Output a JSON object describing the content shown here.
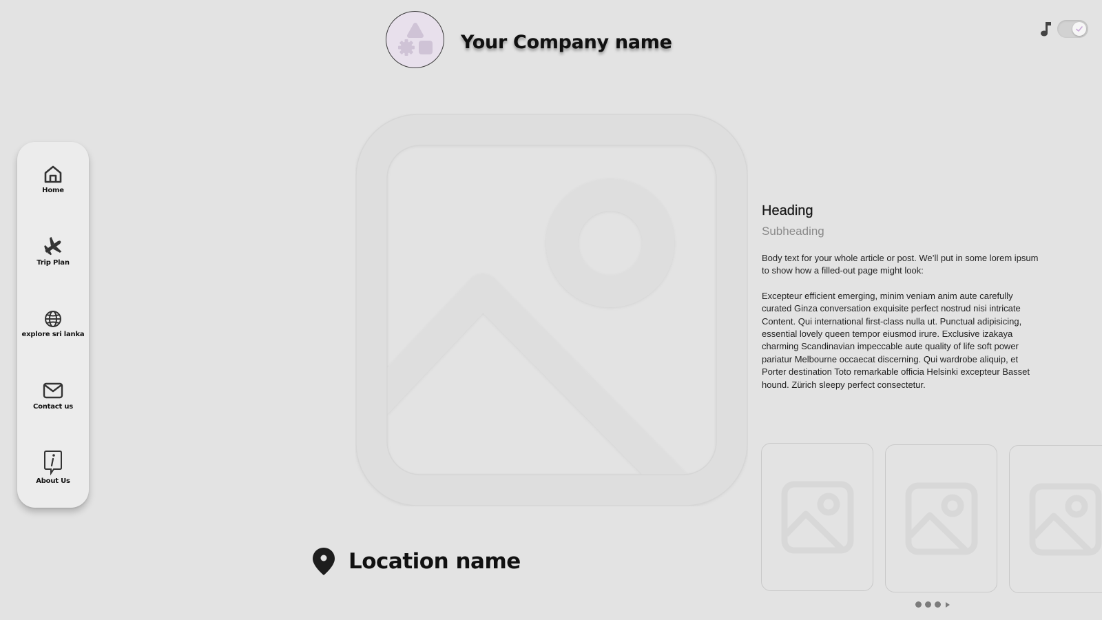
{
  "header": {
    "company_name": "Your Company name"
  },
  "controls": {
    "music_icon": "music-note-icon",
    "toggle_state": "on"
  },
  "sidebar": {
    "items": [
      {
        "label": "Home",
        "icon": "home-icon"
      },
      {
        "label": "Trip Plan",
        "icon": "airplane-icon"
      },
      {
        "label": "explore sri lanka",
        "icon": "globe-icon"
      },
      {
        "label": "Contact us",
        "icon": "mail-icon"
      },
      {
        "label": "About Us",
        "icon": "info-icon"
      }
    ]
  },
  "location": {
    "name": "Location name",
    "icon": "map-pin-icon"
  },
  "article": {
    "heading": "Heading",
    "subheading": "Subheading",
    "paragraphs": [
      "Body text for your whole article or post. We’ll put in some lorem ipsum to show how a filled-out page might look:",
      "Excepteur efficient emerging, minim veniam anim aute carefully curated Ginza conversation exquisite perfect nostrud nisi intricate Content. Qui  international first-class nulla ut. Punctual adipisicing, essential lovely queen tempor eiusmod irure. Exclusive izakaya charming Scandinavian impeccable aute quality of life soft power pariatur Melbourne occaecat discerning. Qui wardrobe aliquip, et Porter destination Toto remarkable officia Helsinki excepteur Basset hound. Zürich sleepy perfect consectetur."
    ]
  },
  "gallery": {
    "thumbnail_count": 3,
    "pager_dots": 3
  },
  "colors": {
    "background": "#e3e3e3",
    "sidebar": "#ececec",
    "logo_bg": "#e8e0ec",
    "logo_accent": "#cfc3d6",
    "text": "#111111",
    "subtle_text": "#8a8a8a"
  }
}
